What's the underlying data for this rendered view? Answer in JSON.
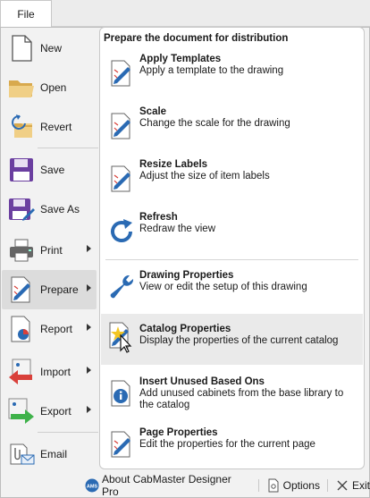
{
  "file_tab": "File",
  "left_menu": {
    "new": "New",
    "open": "Open",
    "revert": "Revert",
    "save": "Save",
    "save_as": "Save As",
    "print": "Print",
    "prepare": "Prepare",
    "report": "Report",
    "import": "Import",
    "export": "Export",
    "email": "Email"
  },
  "panel": {
    "header": "Prepare the document for distribution",
    "items": [
      {
        "title": "Apply Templates",
        "desc": "Apply a template to the drawing"
      },
      {
        "title": "Scale",
        "desc": "Change the scale for the drawing"
      },
      {
        "title": "Resize Labels",
        "desc": "Adjust the size of item labels"
      },
      {
        "title": "Refresh",
        "desc": "Redraw the view"
      },
      {
        "title": "Drawing Properties",
        "desc": "View or edit the setup of this drawing"
      },
      {
        "title": "Catalog Properties",
        "desc": "Display the properties of the current catalog"
      },
      {
        "title": "Insert Unused Based Ons",
        "desc": "Add unused cabinets from the base library to the catalog"
      },
      {
        "title": "Page Properties",
        "desc": "Edit the properties for the current page"
      }
    ]
  },
  "bottom_bar": {
    "about": "About CabMaster Designer Pro",
    "about_icon_text": "AMS",
    "options": "Options",
    "exit": "Exit"
  },
  "colors": {
    "accent_blue": "#2a6ab3",
    "save_purple": "#6b3fa0",
    "folder_tan": "#e8c57a",
    "import_red": "#d9403a",
    "export_green": "#3fb24a"
  }
}
